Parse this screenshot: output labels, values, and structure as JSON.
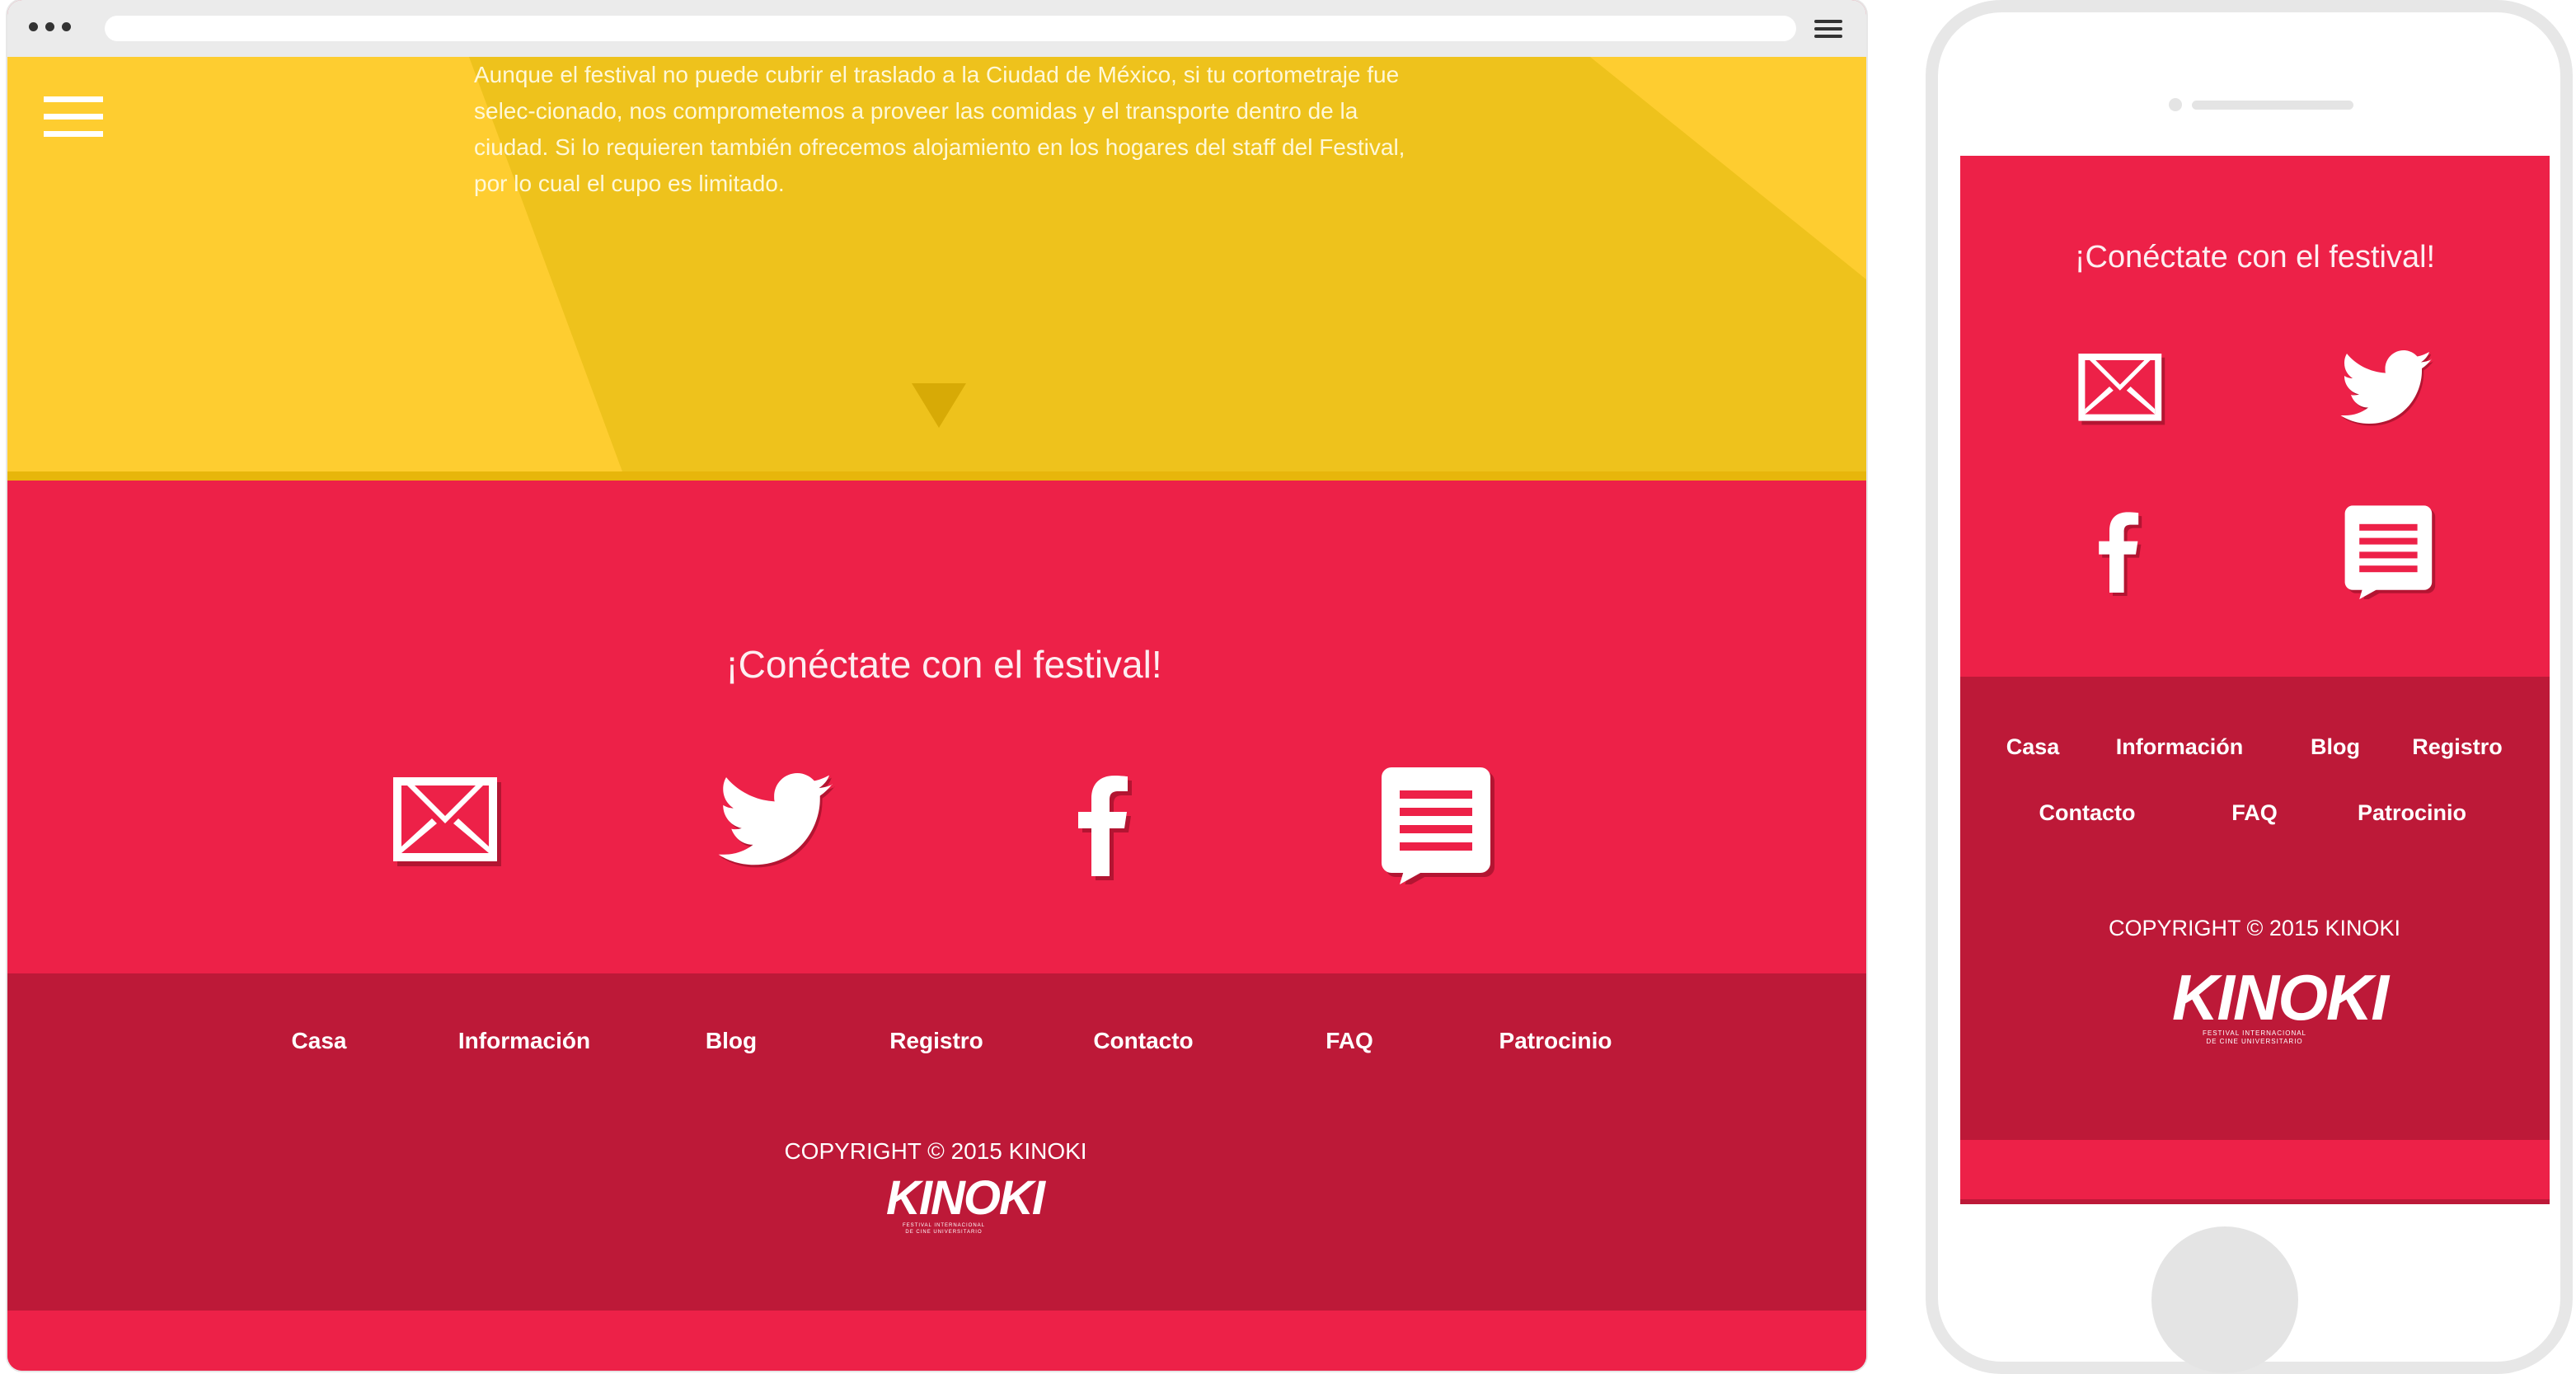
{
  "intro_text": "Aunque el festival no puede cubrir el traslado a la Ciudad de México, si tu cortometraje fue selec-cionado, nos comprometemos a proveer las comidas y el transporte dentro de la ciudad. Si lo requieren también ofrecemos alojamiento en los hogares del staff del Festival, por lo cual el cupo es limitado.",
  "connect_title": "¡Conéctate con el festival!",
  "social": [
    {
      "icon": "mail-icon"
    },
    {
      "icon": "twitter-icon"
    },
    {
      "icon": "facebook-icon"
    },
    {
      "icon": "chat-icon"
    }
  ],
  "nav": [
    "Casa",
    "Información",
    "Blog",
    "Registro",
    "Contacto",
    "FAQ",
    "Patrocinio"
  ],
  "copyright": "COPYRIGHT © 2015 KINOKI",
  "logo": {
    "word": "KINOKI",
    "sub_line1": "FESTIVAL INTERNACIONAL",
    "sub_line2": "DE CINE UNIVERSITARIO"
  },
  "colors": {
    "yellow": "#fecd30",
    "pink": "#ed2148",
    "dark_pink": "#bd1938"
  }
}
